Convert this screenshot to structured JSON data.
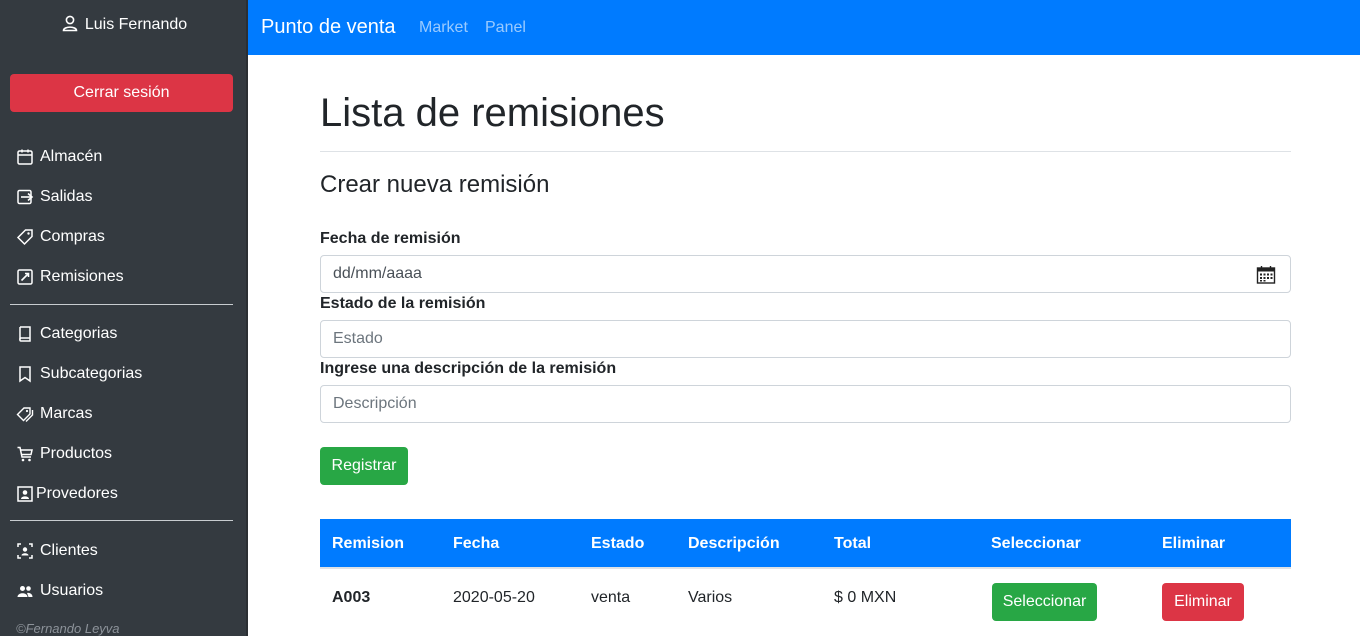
{
  "sidebar": {
    "user_name": "Luis Fernando",
    "logout_label": "Cerrar sesión",
    "groups": [
      [
        {
          "label": "Almacén",
          "icon": "calendar-box-icon"
        },
        {
          "label": "Salidas",
          "icon": "exit-icon"
        },
        {
          "label": "Compras",
          "icon": "tag-icon"
        },
        {
          "label": "Remisiones",
          "icon": "check-square-icon"
        }
      ],
      [
        {
          "label": "Categorias",
          "icon": "book-icon"
        },
        {
          "label": "Subcategorias",
          "icon": "bookmark-icon"
        },
        {
          "label": "Marcas",
          "icon": "tags-icon"
        },
        {
          "label": "Productos",
          "icon": "cart-icon"
        },
        {
          "label": "Provedores",
          "icon": "person-box-icon"
        }
      ],
      [
        {
          "label": "Clientes",
          "icon": "person-bounding-icon"
        },
        {
          "label": "Usuarios",
          "icon": "people-icon"
        }
      ]
    ],
    "footer": "©Fernando Leyva"
  },
  "navbar": {
    "brand": "Punto de venta",
    "links": [
      "Market",
      "Panel"
    ]
  },
  "main": {
    "title": "Lista de remisiones",
    "subtitle": "Crear nueva remisión",
    "form": {
      "date_label": "Fecha de remisión",
      "date_placeholder": "dd/mm/aaaa",
      "status_label": "Estado de la remisión",
      "status_placeholder": "Estado",
      "desc_label": "Ingrese una descripción de la remisión",
      "desc_placeholder": "Descripción",
      "submit_label": "Registrar"
    },
    "table": {
      "headers": [
        "Remision",
        "Fecha",
        "Estado",
        "Descripción",
        "Total",
        "Seleccionar",
        "Eliminar"
      ],
      "rows": [
        {
          "remision": "A003",
          "fecha": "2020-05-20",
          "estado": "venta",
          "descripcion": "Varios",
          "total": "$ 0 MXN",
          "select_label": "Seleccionar",
          "delete_label": "Eliminar"
        }
      ]
    }
  },
  "colors": {
    "primary": "#007bff",
    "danger": "#dc3545",
    "success": "#28a745",
    "sidebar": "#343a40"
  }
}
